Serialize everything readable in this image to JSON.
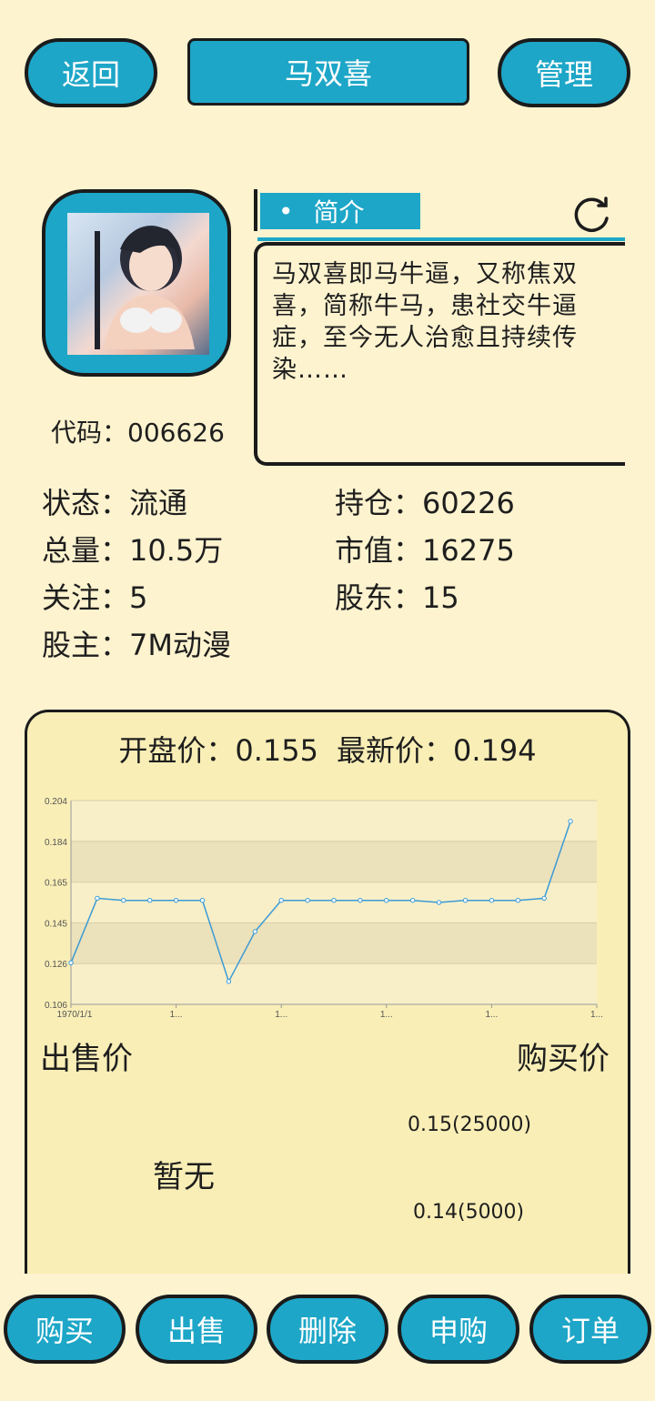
{
  "header": {
    "back_label": "返回",
    "title": "马双喜",
    "manage_label": "管理"
  },
  "profile": {
    "code_label": "代码：",
    "code": "006626",
    "intro_tag": "简介",
    "intro_bullet": "•",
    "intro_text": "马双喜即马牛逼，又称焦双喜，简称牛马，患社交牛逼症，至今无人治愈且持续传染……"
  },
  "stats": {
    "status_label": "状态：",
    "status_value": "流通",
    "holding_label": "持仓：",
    "holding_value": "60226",
    "total_label": "总量：",
    "total_value": "10.5万",
    "market_value_label": "市值：",
    "market_value": "16275",
    "follow_label": "关注：",
    "follow_value": "5",
    "shareholders_label": "股东：",
    "shareholders_value": "15",
    "owner_label": "股主：",
    "owner_value": "7M动漫"
  },
  "prices": {
    "open_label": "开盘价：",
    "open_value": "0.155",
    "latest_label": "最新价：",
    "latest_value": "0.194"
  },
  "chart_data": {
    "type": "line",
    "y_ticks": [
      "0.204",
      "0.184",
      "0.165",
      "0.145",
      "0.126",
      "0.106"
    ],
    "ylim": [
      0.106,
      0.204
    ],
    "x_ticks": [
      "1970/1/1",
      "1...",
      "1...",
      "1...",
      "1...",
      "1..."
    ],
    "values": [
      0.126,
      0.157,
      0.156,
      0.156,
      0.156,
      0.156,
      0.117,
      0.141,
      0.156,
      0.156,
      0.156,
      0.156,
      0.156,
      0.156,
      0.155,
      0.156,
      0.156,
      0.156,
      0.157,
      0.194
    ],
    "line_color": "#3b9bd6",
    "grid": true
  },
  "orders": {
    "sell_label": "出售价",
    "buy_label": "购买价",
    "sell_empty": "暂无",
    "buy_items": [
      "0.15(25000)",
      "0.14(5000)"
    ]
  },
  "actions": {
    "buy": "购买",
    "sell": "出售",
    "delete": "删除",
    "subscribe": "申购",
    "orders": "订单"
  },
  "colors": {
    "accent": "#1da6c7",
    "background": "#fdf3cf",
    "card": "#f9eeb6"
  }
}
